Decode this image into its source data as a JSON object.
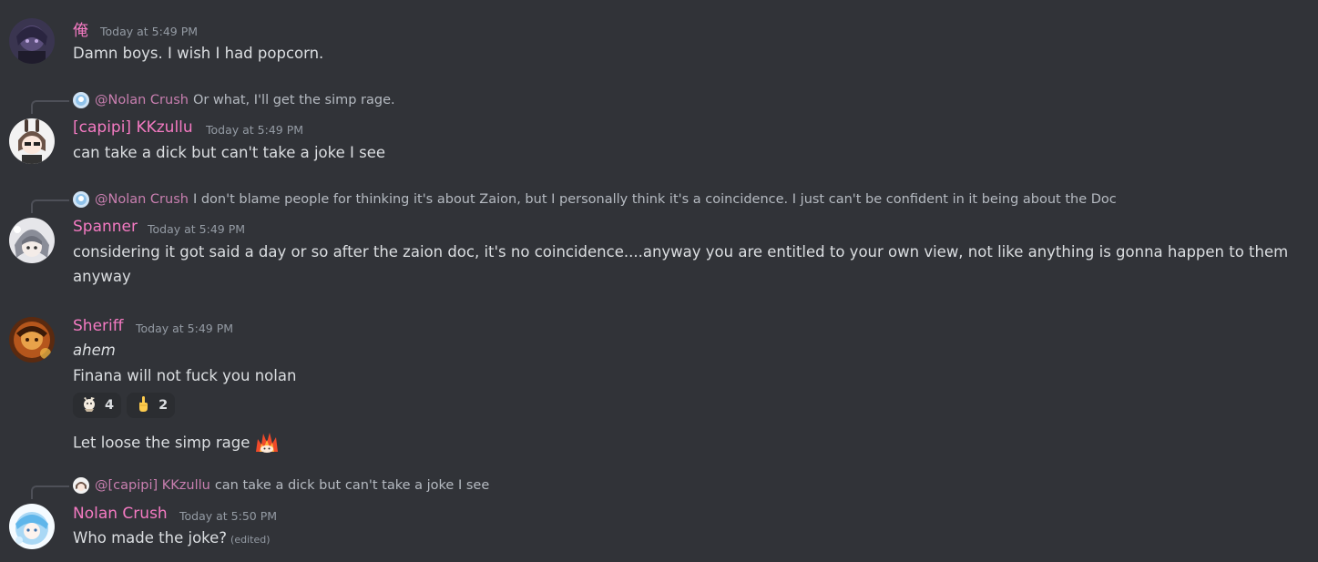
{
  "messages": [
    {
      "username": "俺",
      "timestamp": "Today at 5:49 PM",
      "lines": [
        "Damn boys. I wish I had popcorn."
      ]
    },
    {
      "reply": {
        "name": "@Nolan Crush",
        "text": "Or what, I'll get the simp rage."
      },
      "username": "[capipi] KKzullu",
      "timestamp": "Today at 5:49 PM",
      "lines": [
        "can take a dick but can't take a joke I see"
      ]
    },
    {
      "reply": {
        "name": "@Nolan Crush",
        "text": "I don't blame people for thinking it's about Zaion, but I personally think it's a coincidence. I just can't be confident in it being about the Doc"
      },
      "username": "Spanner",
      "timestamp": "Today at 5:49 PM",
      "lines": [
        "considering it got said a day or so after the zaion doc, it's no coincidence....anyway you are entitled to your own view, not like anything is gonna happen to them",
        "anyway"
      ]
    },
    {
      "username": "Sheriff",
      "timestamp": "Today at 5:49 PM",
      "lines": [
        "ahem",
        "Finana will not fuck you nolan"
      ],
      "reactions": [
        {
          "emoji": "custom-character-emoji",
          "count": "4"
        },
        {
          "emoji": "middle-finger-emoji",
          "count": "2"
        }
      ],
      "followup": "Let loose the simp rage"
    },
    {
      "reply": {
        "name": "@[capipi] KKzullu",
        "text": "can take a dick but can't take a joke I see"
      },
      "username": "Nolan Crush",
      "timestamp": "Today at 5:50 PM",
      "lines": [
        "Who made the joke?"
      ],
      "edited": "(edited)"
    }
  ],
  "colors": {
    "background": "#313338",
    "username": "#f47fff",
    "timestamp": "#949ba4",
    "text": "#dbdee1",
    "reply_text": "#b5bac1",
    "reaction_bg": "#2b2d31"
  }
}
